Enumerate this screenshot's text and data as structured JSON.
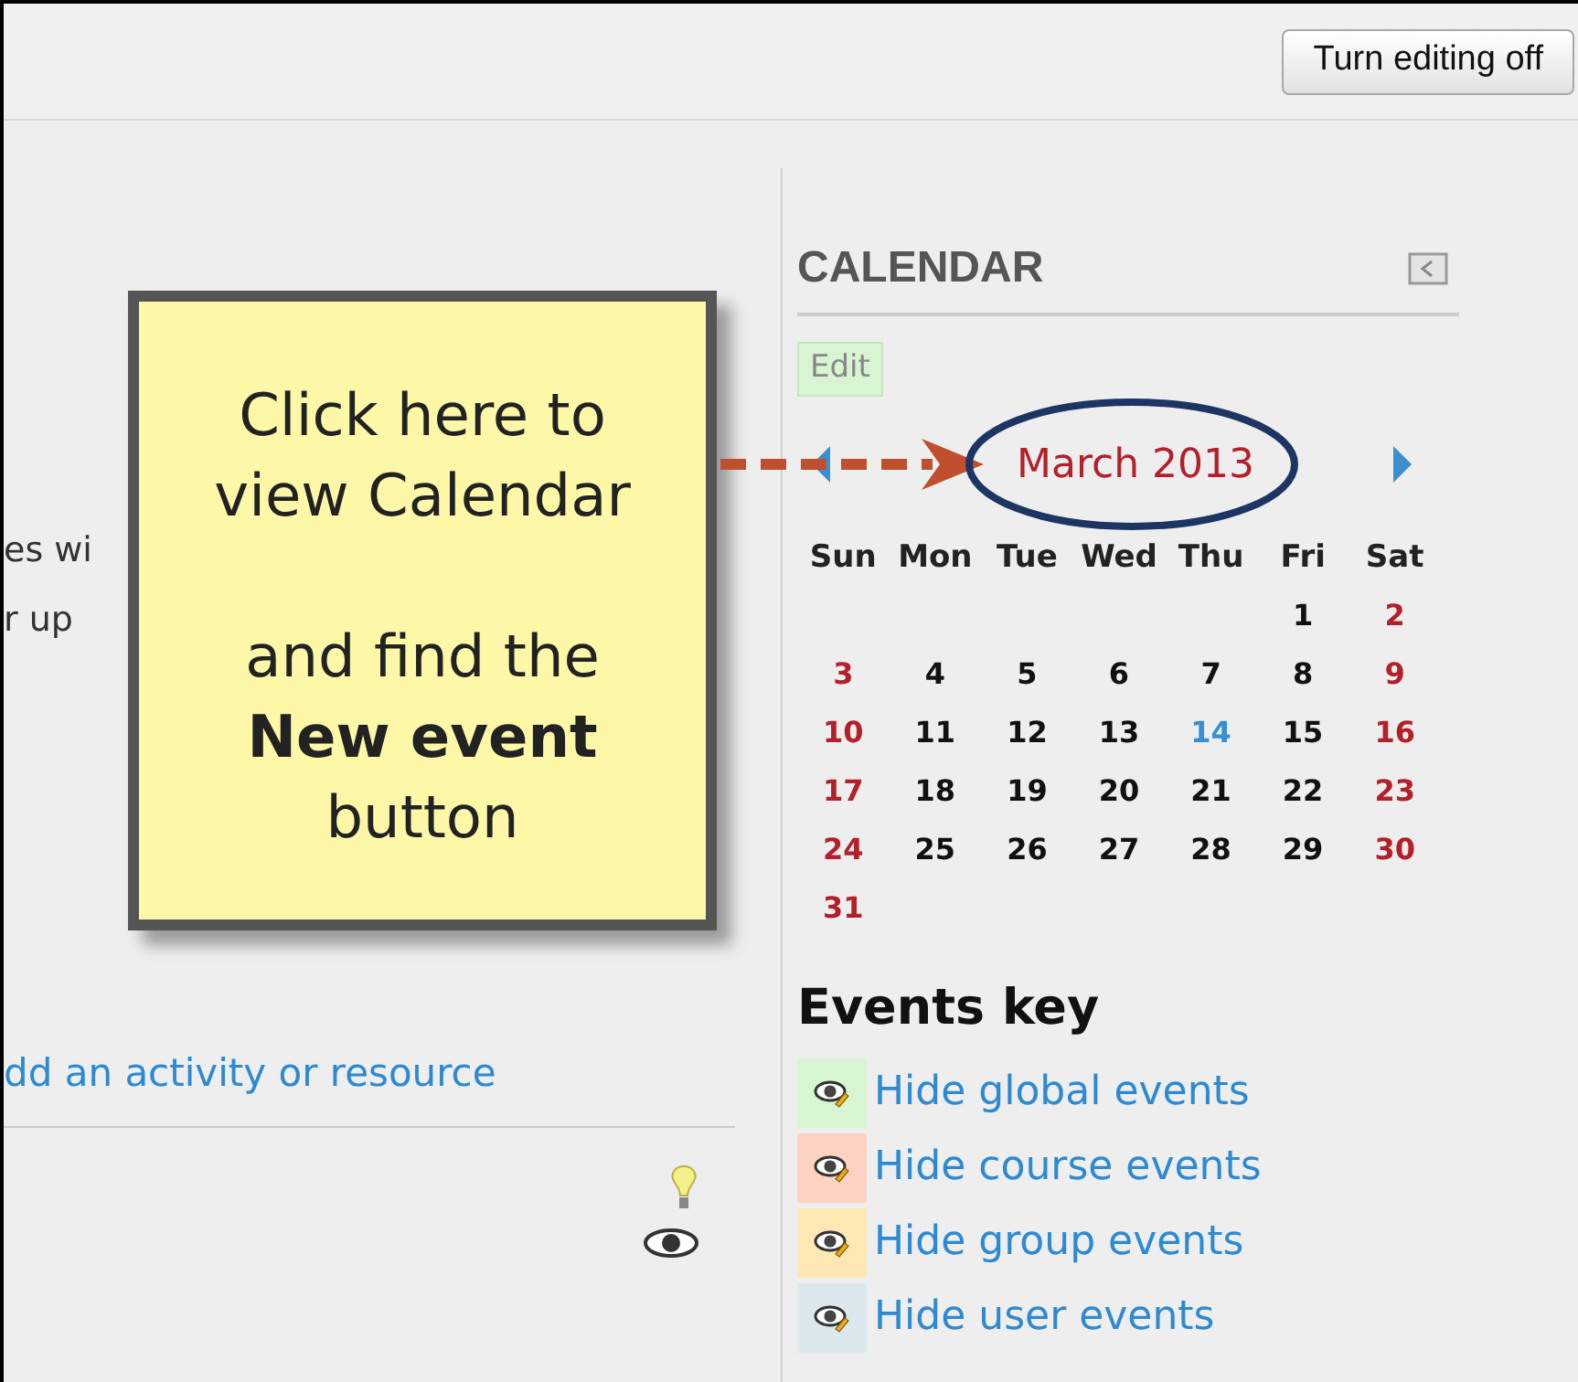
{
  "header": {
    "button": "Turn editing off"
  },
  "left": {
    "fragments": [
      "es wi",
      "r up"
    ],
    "add_link": "dd an activity or resource"
  },
  "calendar": {
    "title": "CALENDAR",
    "edit": "Edit",
    "month": "March 2013",
    "weekdays": [
      "Sun",
      "Mon",
      "Tue",
      "Wed",
      "Thu",
      "Fri",
      "Sat"
    ],
    "weeks": [
      [
        {
          "day": "1",
          "kind": "weekday"
        },
        {
          "day": "2",
          "kind": "weekend"
        }
      ],
      [
        {
          "day": "3",
          "kind": "weekend"
        },
        {
          "day": "4",
          "kind": "weekday"
        },
        {
          "day": "5",
          "kind": "weekday"
        },
        {
          "day": "6",
          "kind": "weekday"
        },
        {
          "day": "7",
          "kind": "weekday"
        },
        {
          "day": "8",
          "kind": "weekday"
        },
        {
          "day": "9",
          "kind": "weekend"
        }
      ],
      [
        {
          "day": "10",
          "kind": "weekend"
        },
        {
          "day": "11",
          "kind": "weekday"
        },
        {
          "day": "12",
          "kind": "weekday"
        },
        {
          "day": "13",
          "kind": "weekday"
        },
        {
          "day": "14",
          "kind": "today"
        },
        {
          "day": "15",
          "kind": "weekday"
        },
        {
          "day": "16",
          "kind": "weekend"
        }
      ],
      [
        {
          "day": "17",
          "kind": "weekend"
        },
        {
          "day": "18",
          "kind": "weekday"
        },
        {
          "day": "19",
          "kind": "weekday"
        },
        {
          "day": "20",
          "kind": "weekday"
        },
        {
          "day": "21",
          "kind": "weekday"
        },
        {
          "day": "22",
          "kind": "weekday"
        },
        {
          "day": "23",
          "kind": "weekend"
        }
      ],
      [
        {
          "day": "24",
          "kind": "weekend"
        },
        {
          "day": "25",
          "kind": "weekday"
        },
        {
          "day": "26",
          "kind": "weekday"
        },
        {
          "day": "27",
          "kind": "weekday"
        },
        {
          "day": "28",
          "kind": "weekday"
        },
        {
          "day": "29",
          "kind": "weekday"
        },
        {
          "day": "30",
          "kind": "weekend"
        }
      ],
      [
        {
          "day": "31",
          "kind": "weekend"
        }
      ]
    ]
  },
  "events_key": {
    "title": "Events key",
    "items": [
      {
        "label": "Hide global events",
        "color": "#d7f5d0"
      },
      {
        "label": "Hide course events",
        "color": "#fcd2c2"
      },
      {
        "label": "Hide group events",
        "color": "#fde8b4"
      },
      {
        "label": "Hide user events",
        "color": "#dce8ee"
      }
    ]
  },
  "callout": {
    "lines": [
      "Click here to",
      "view Calendar",
      "and find the",
      "**New event**",
      "button"
    ]
  }
}
